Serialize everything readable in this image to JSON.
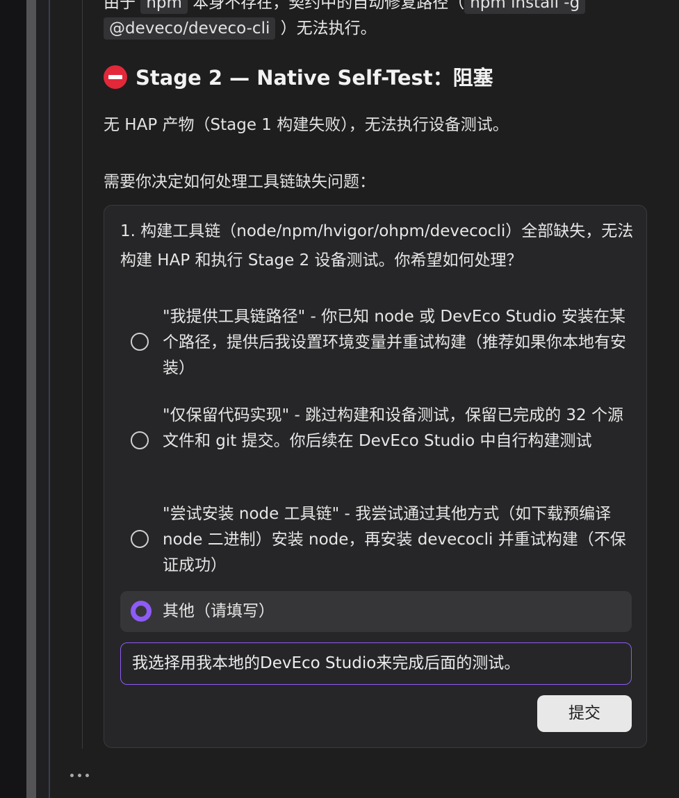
{
  "top_line": {
    "prefix": "由于",
    "code1": "npm",
    "middle": "本身不存在，契约中的自动修复路径（",
    "code2a": "npm install -g",
    "code2b": "@deveco/deveco-cli",
    "suffix": "）无法执行。"
  },
  "heading": {
    "icon": "no-entry-icon",
    "text": "Stage 2 — Native Self-Test：阻塞"
  },
  "paragraphs": [
    "无 HAP 产物（Stage 1 构建失败），无法执行设备测试。",
    "需要你决定如何处理工具链缺失问题："
  ],
  "question_card": {
    "question": "1. 构建工具链（node/npm/hvigor/ohpm/devecocli）全部缺失，无法构建 HAP 和执行 Stage 2 设备测试。你希望如何处理？",
    "options": [
      {
        "label": "\"我提供工具链路径\" - 你已知 node 或 DevEco Studio 安装在某个路径，提供后我设置环境变量并重试构建（推荐如果你本地有安装）",
        "selected": false
      },
      {
        "label": "\"仅保留代码实现\" - 跳过构建和设备测试，保留已完成的 32 个源文件和 git 提交。你后续在 DevEco Studio 中自行构建测试",
        "selected": false
      },
      {
        "label": "\"尝试安装 node 工具链\" - 我尝试通过其他方式（如下载预编译 node 二进制）安装 node，再安装 devecocli 并重试构建（不保证成功）",
        "selected": false
      },
      {
        "label": "其他（请填写）",
        "selected": true
      }
    ],
    "input_value": "我选择用我本地的DevEco Studio来完成后面的测试。",
    "submit_label": "提交"
  },
  "colors": {
    "accent": "#8e5bf6",
    "background": "#1e1e1f",
    "card": "#262628",
    "stop": "#e3283a"
  }
}
